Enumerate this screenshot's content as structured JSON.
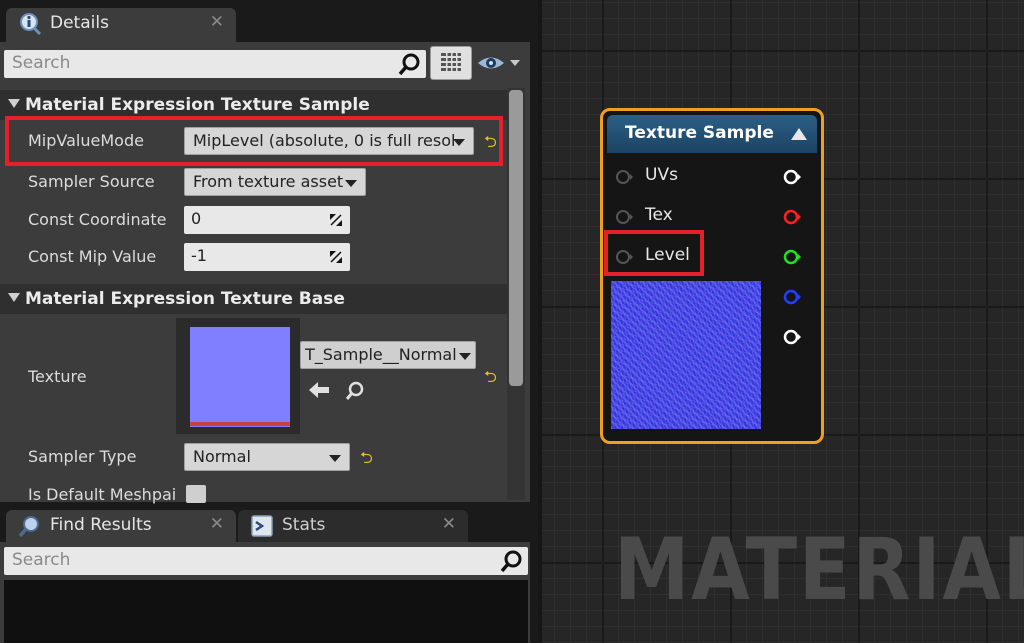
{
  "details_tab": {
    "title": "Details"
  },
  "details": {
    "search_placeholder": "Search",
    "section1": {
      "title": "Material Expression Texture Sample",
      "rows": [
        {
          "label": "MipValueMode",
          "value": "MipLevel (absolute, 0 is full resol"
        },
        {
          "label": "Sampler Source",
          "value": "From texture asset"
        },
        {
          "label": "Const Coordinate",
          "value": "0"
        },
        {
          "label": "Const Mip Value",
          "value": "-1"
        }
      ]
    },
    "section2": {
      "title": "Material Expression Texture Base",
      "texture_label": "Texture",
      "texture_value": "T_Sample__Normal",
      "sampler_type_label": "Sampler Type",
      "sampler_type_value": "Normal",
      "default_meshpaint_label": "Is Default Meshpai"
    },
    "texture_color": "#7f7fff"
  },
  "bottom_tabs": [
    {
      "title": "Find Results"
    },
    {
      "title": "Stats"
    }
  ],
  "find_search_placeholder": "Search",
  "node": {
    "title": "Texture Sample",
    "inputs": [
      "UVs",
      "Tex",
      "Level"
    ],
    "output_colors": [
      "#ffffff",
      "#ff2020",
      "#20e020",
      "#2040ff",
      "#ffffff"
    ],
    "border_color": "#f0a020"
  },
  "highlight_color": "#e3202b",
  "watermark": "MATERIAL"
}
